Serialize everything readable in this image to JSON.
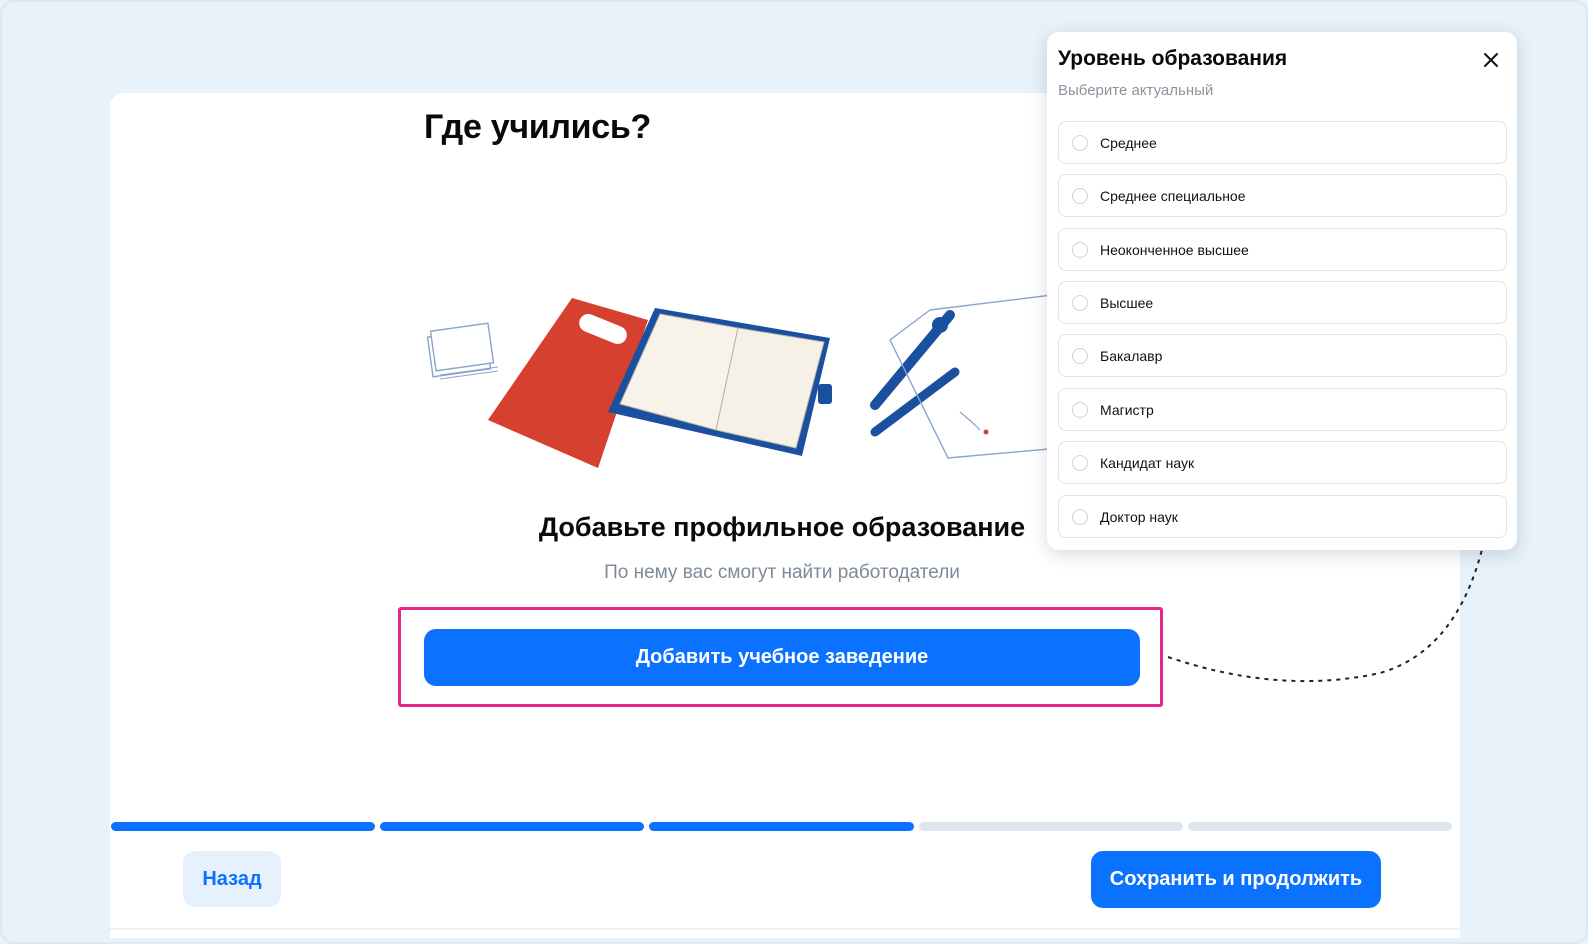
{
  "page": {
    "title": "Где учились?",
    "section_title": "Добавьте профильное образование",
    "section_subtitle": "По нему вас смогут найти работодатели",
    "add_button": "Добавить учебное заведение"
  },
  "progress": {
    "completed_steps": 3,
    "total_steps": 5
  },
  "footer": {
    "back_label": "Назад",
    "save_label": "Сохранить и продолжить"
  },
  "popup": {
    "title": "Уровень образования",
    "subtitle": "Выберите актуальный",
    "options": [
      "Среднее",
      "Среднее специальное",
      "Неоконченное высшее",
      "Высшее",
      "Бакалавр",
      "Магистр",
      "Кандидат наук",
      "Доктор наук"
    ]
  },
  "colors": {
    "primary": "#0a72ff",
    "highlight": "#e0288c",
    "background": "#e8f2fa",
    "progress_inactive": "#dfe5ec"
  },
  "icons": {
    "close": "close-icon",
    "radio": "radio-icon"
  }
}
